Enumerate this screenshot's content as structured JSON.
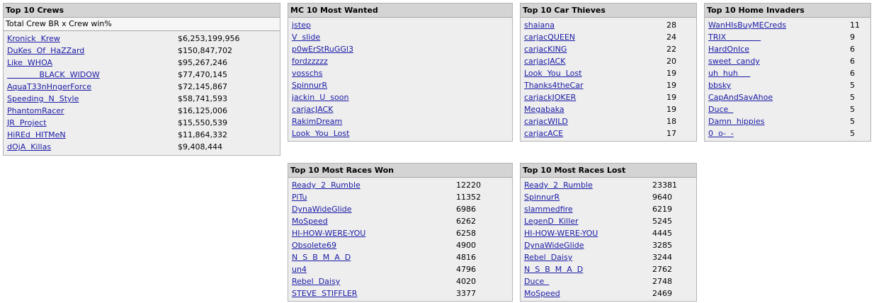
{
  "panels": {
    "crews": {
      "title": "Top 10 Crews",
      "subtitle": "Total Crew BR x Crew win%",
      "rows": [
        {
          "name": "Kronick  Krew",
          "value": "$6,253,199,956"
        },
        {
          "name": "DuKes  Of  HaZZard",
          "value": "$150,847,702"
        },
        {
          "name": "Like  WHOA",
          "value": "$95,267,246"
        },
        {
          "name": "             BLACK  WIDOW",
          "value": "$77,470,145"
        },
        {
          "name": "AquaT33nHngerForce",
          "value": "$72,145,867"
        },
        {
          "name": "Speeding  N  Style",
          "value": "$58,741,593"
        },
        {
          "name": "PhantomRacer",
          "value": "$16,125,006"
        },
        {
          "name": "JR  Project",
          "value": "$15,550,539"
        },
        {
          "name": "HiREd  HITMeN",
          "value": "$11,864,332"
        },
        {
          "name": "dOjA  Killas",
          "value": "$9,408,444"
        }
      ]
    },
    "wanted": {
      "title": "MC 10 Most Wanted",
      "rows": [
        {
          "name": "jstep"
        },
        {
          "name": "V  slide"
        },
        {
          "name": "p0wErStRuGGl3"
        },
        {
          "name": "fordzzzzz"
        },
        {
          "name": "vosschs"
        },
        {
          "name": "SpinnurR"
        },
        {
          "name": "jackin  U  soon"
        },
        {
          "name": "carjacJACK"
        },
        {
          "name": "RakimDream"
        },
        {
          "name": "Look  You  Lost"
        }
      ]
    },
    "thieves": {
      "title": "Top 10 Car Thieves",
      "rows": [
        {
          "name": "shaiana",
          "value": "28"
        },
        {
          "name": "carjacQUEEN",
          "value": "24"
        },
        {
          "name": "carjacKING",
          "value": "22"
        },
        {
          "name": "carjacJACK",
          "value": "20"
        },
        {
          "name": "Look  You  Lost",
          "value": "19"
        },
        {
          "name": "Thanks4theCar",
          "value": "19"
        },
        {
          "name": "carjackJOKER",
          "value": "19"
        },
        {
          "name": "Megabaka",
          "value": "19"
        },
        {
          "name": "carjacWILD",
          "value": "18"
        },
        {
          "name": "carjacACE",
          "value": "17"
        }
      ]
    },
    "invaders": {
      "title": "Top 10 Home Invaders",
      "rows": [
        {
          "name": "WanHIsBuyMECreds",
          "value": "11"
        },
        {
          "name": "TRIX              ",
          "value": "9"
        },
        {
          "name": "HardOnIce",
          "value": "6"
        },
        {
          "name": "sweet  candy",
          "value": "6"
        },
        {
          "name": "uh  huh     ",
          "value": "6"
        },
        {
          "name": "bbsky",
          "value": "5"
        },
        {
          "name": "CapAndSavAhoe",
          "value": "5"
        },
        {
          "name": "Duce  ",
          "value": "5"
        },
        {
          "name": "Damn  hippies",
          "value": "5"
        },
        {
          "name": "0  o-  -",
          "value": "5"
        }
      ]
    },
    "won": {
      "title": "Top 10 Most Races Won",
      "rows": [
        {
          "name": "Ready  2  Rumble",
          "value": "12220"
        },
        {
          "name": "PiTu",
          "value": "11352"
        },
        {
          "name": "DynaWideGlide",
          "value": "6986"
        },
        {
          "name": "MoSpeed",
          "value": "6262"
        },
        {
          "name": "HI-HOW-WERE-YOU",
          "value": "6258"
        },
        {
          "name": "Obsolete69",
          "value": "4900"
        },
        {
          "name": "N  S  B  M  A  D",
          "value": "4816"
        },
        {
          "name": "un4",
          "value": "4796"
        },
        {
          "name": "Rebel  Daisy",
          "value": "4020"
        },
        {
          "name": "STEVE  STIFFLER",
          "value": "3377"
        }
      ]
    },
    "lost": {
      "title": "Top 10 Most Races Lost",
      "rows": [
        {
          "name": "Ready  2  Rumble",
          "value": "23381"
        },
        {
          "name": "SpinnurR",
          "value": "9640"
        },
        {
          "name": "slammedfire",
          "value": "6219"
        },
        {
          "name": "LegenD  Killer",
          "value": "5245"
        },
        {
          "name": "HI-HOW-WERE-YOU",
          "value": "4445"
        },
        {
          "name": "DynaWideGlide",
          "value": "3285"
        },
        {
          "name": "Rebel  Daisy",
          "value": "3244"
        },
        {
          "name": "N  S  B  M  A  D",
          "value": "2762"
        },
        {
          "name": "Duce  ",
          "value": "2748"
        },
        {
          "name": "MoSpeed",
          "value": "2469"
        }
      ]
    }
  }
}
